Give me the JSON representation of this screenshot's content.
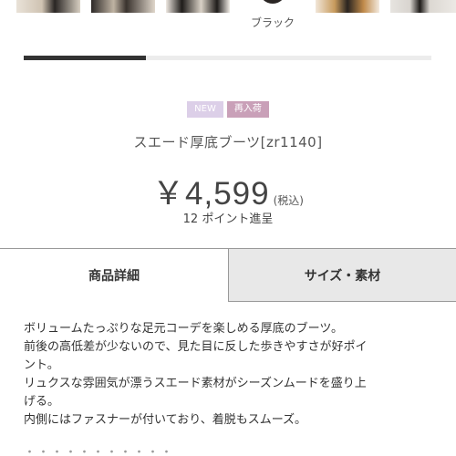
{
  "color_swatches": {
    "selected_label": "ブラック"
  },
  "image_progress": 0.3,
  "badges": {
    "new": "NEW",
    "restock": "再入荷"
  },
  "product": {
    "name": "スエード厚底ブーツ[zr1140]",
    "price": "￥4,599",
    "tax_note": "(税込)",
    "points": "12 ポイント進呈"
  },
  "tabs": {
    "details": "商品詳細",
    "size_material": "サイズ・素材"
  },
  "description": {
    "lines": [
      "ボリュームたっぷりな足元コーデを楽しめる厚底のブーツ。",
      "前後の高低差が少ないので、見た目に反した歩きやすさが好ポイ",
      "ント。",
      "リュクスな雰囲気が漂うスエード素材がシーズンムードを盛り上",
      "げる。",
      "内側にはファスナーが付いており、着脱もスムーズ。"
    ]
  }
}
